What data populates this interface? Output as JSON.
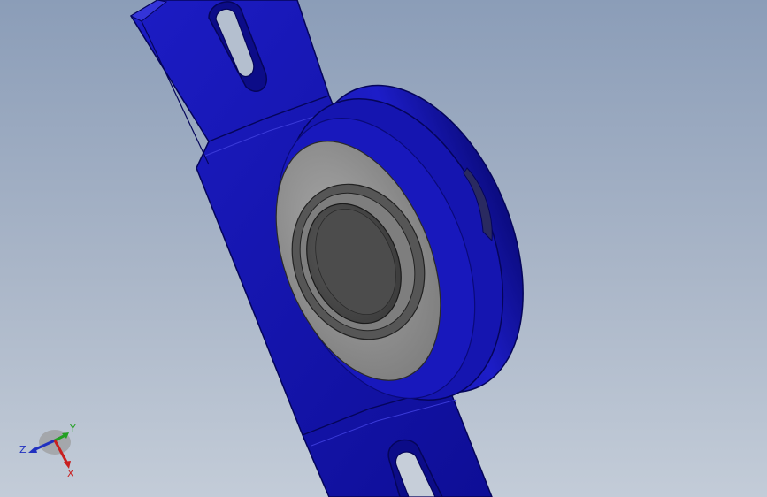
{
  "viewport": {
    "model": "pillow-block-bearing",
    "colors": {
      "background_top": "#8b9db8",
      "background_bottom": "#c3ccd8",
      "housing": "#1a1ab5",
      "housing_dark": "#0a0a78",
      "bearing_face": "#8f8f8f",
      "bore": "#4a4a4a"
    }
  },
  "triad": {
    "x_label": "X",
    "y_label": "Y",
    "z_label": "Z",
    "x_color": "#c82020",
    "y_color": "#22a022",
    "z_color": "#2030c0"
  }
}
